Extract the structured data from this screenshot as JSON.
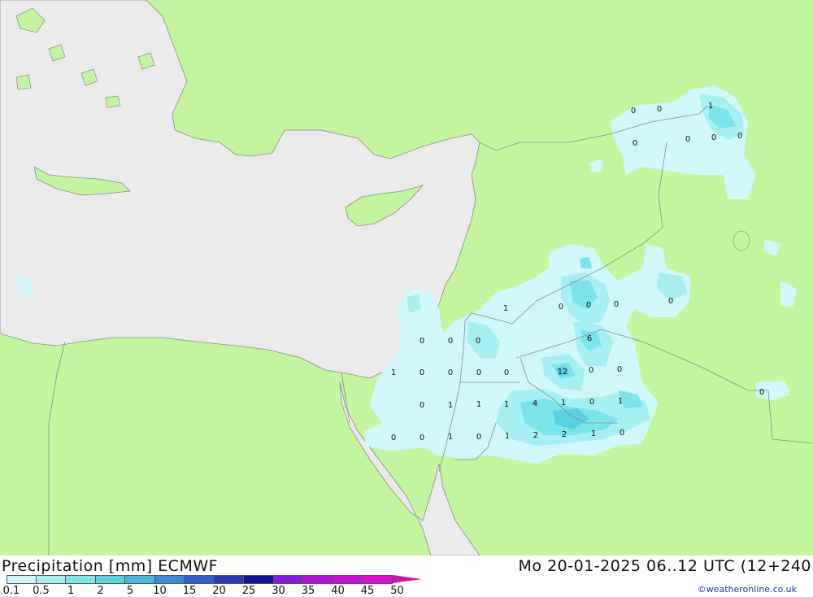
{
  "header": {
    "title": "Precipitation [mm] ECMWF",
    "datetime": "Mo 20-01-2025 06..12 UTC (12+240",
    "credit": "©weatheronline.co.uk"
  },
  "colors": {
    "land": "#c4f6a0",
    "sea": "#ebebeb",
    "border": "#8a8a8a"
  },
  "legend": {
    "labels": [
      "0.1",
      "0.5",
      "1",
      "2",
      "5",
      "10",
      "15",
      "20",
      "25",
      "30",
      "35",
      "40",
      "45",
      "50"
    ],
    "colors": [
      "#d0f8fa",
      "#a6f0f0",
      "#7ae4ea",
      "#5ad0e2",
      "#48b4e0",
      "#3c8ade",
      "#3060d4",
      "#2638bc",
      "#10109c",
      "#8c14e8",
      "#b412dc",
      "#d20ae4",
      "#e608d4",
      "#c418b0"
    ]
  },
  "values": [
    {
      "id": "v1",
      "text": "0"
    },
    {
      "id": "v2",
      "text": "0"
    },
    {
      "id": "v3",
      "text": "1"
    },
    {
      "id": "v4",
      "text": "0"
    },
    {
      "id": "v5",
      "text": "0"
    },
    {
      "id": "v6",
      "text": "0"
    },
    {
      "id": "v7",
      "text": "0"
    },
    {
      "id": "v8",
      "text": "1"
    },
    {
      "id": "v9",
      "text": "0"
    },
    {
      "id": "v10",
      "text": "0"
    },
    {
      "id": "v11",
      "text": "0"
    },
    {
      "id": "v12",
      "text": "0"
    },
    {
      "id": "v13",
      "text": "0"
    },
    {
      "id": "v14",
      "text": "0"
    },
    {
      "id": "v15",
      "text": "0"
    },
    {
      "id": "v16",
      "text": "6"
    },
    {
      "id": "v17",
      "text": "1"
    },
    {
      "id": "v18",
      "text": "0"
    },
    {
      "id": "v19",
      "text": "0"
    },
    {
      "id": "v20",
      "text": "0"
    },
    {
      "id": "v21",
      "text": "0"
    },
    {
      "id": "v22",
      "text": "12"
    },
    {
      "id": "v23",
      "text": "0"
    },
    {
      "id": "v24",
      "text": "0"
    },
    {
      "id": "v25",
      "text": "0"
    },
    {
      "id": "v26",
      "text": "0"
    },
    {
      "id": "v27",
      "text": "1"
    },
    {
      "id": "v28",
      "text": "1"
    },
    {
      "id": "v29",
      "text": "1"
    },
    {
      "id": "v30",
      "text": "4"
    },
    {
      "id": "v31",
      "text": "1"
    },
    {
      "id": "v32",
      "text": "0"
    },
    {
      "id": "v33",
      "text": "1"
    },
    {
      "id": "v34",
      "text": "0"
    },
    {
      "id": "v35",
      "text": "0"
    },
    {
      "id": "v36",
      "text": "1"
    },
    {
      "id": "v37",
      "text": "0"
    },
    {
      "id": "v38",
      "text": "1"
    },
    {
      "id": "v39",
      "text": "2"
    },
    {
      "id": "v40",
      "text": "2"
    },
    {
      "id": "v41",
      "text": "1"
    },
    {
      "id": "v42",
      "text": "0"
    }
  ]
}
